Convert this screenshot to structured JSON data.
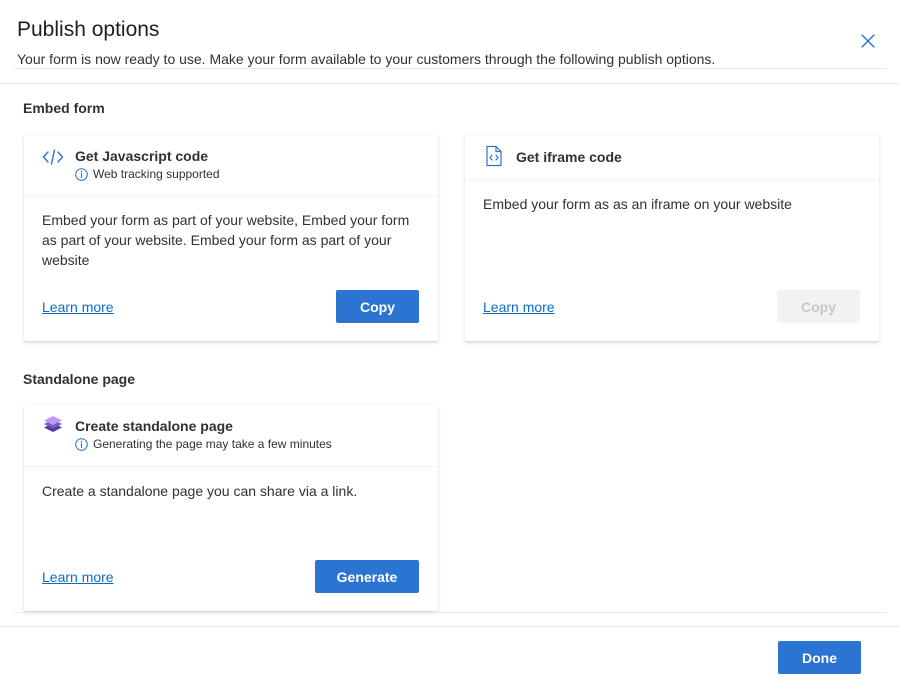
{
  "dialog": {
    "title": "Publish options",
    "subtitle": "Your form is now ready to use. Make your form available to your customers through the following publish options.",
    "close_icon": "close-icon"
  },
  "sections": {
    "embed_label": "Embed form",
    "standalone_label": "Standalone page"
  },
  "cards": {
    "javascript": {
      "icon": "code-icon",
      "title": "Get Javascript code",
      "info": "Web tracking supported",
      "description": "Embed your form as part of your website, Embed your form as part of your website. Embed your form as part of your website",
      "learn_more": "Learn more",
      "button": "Copy",
      "button_enabled": true
    },
    "iframe": {
      "icon": "iframe-document-icon",
      "title": "Get iframe code",
      "description": "Embed your form as as an iframe on your website",
      "learn_more": "Learn more",
      "button": "Copy",
      "button_enabled": false
    },
    "standalone": {
      "icon": "layers-icon",
      "title": "Create standalone page",
      "info": "Generating the page may take a few minutes",
      "description": "Create a standalone page you can share via a link.",
      "learn_more": "Learn more",
      "button": "Generate",
      "button_enabled": true
    }
  },
  "footer": {
    "done_label": "Done"
  },
  "colors": {
    "primary": "#2b74d2",
    "link": "#0f6cbd",
    "icon_blue": "#2b74d2",
    "layers_purple": "#7c5cc4"
  }
}
